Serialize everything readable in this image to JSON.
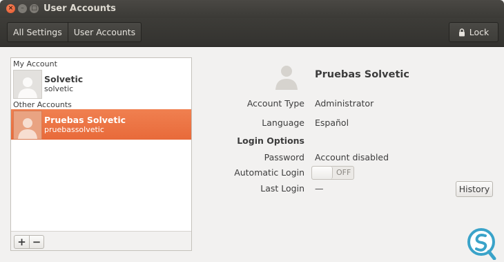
{
  "window": {
    "title": "User Accounts",
    "close_glyph": "×",
    "minimize_glyph": "–",
    "maximize_glyph": "□"
  },
  "toolbar": {
    "breadcrumbs": [
      "All Settings",
      "User Accounts"
    ],
    "lock_label": "Lock",
    "lock_icon": "lock-icon"
  },
  "accounts": {
    "my_account_label": "My Account",
    "other_accounts_label": "Other Accounts",
    "my_account": {
      "name": "Solvetic",
      "username": "solvetic",
      "icon": "user-avatar-icon"
    },
    "others": [
      {
        "name": "Pruebas Solvetic",
        "username": "pruebassolvetic",
        "icon": "user-avatar-icon",
        "selected": true
      }
    ],
    "add_label": "+",
    "remove_label": "−"
  },
  "details": {
    "full_name": "Pruebas Solvetic",
    "account_type_label": "Account Type",
    "account_type_value": "Administrator",
    "language_label": "Language",
    "language_value": "Español",
    "login_options_label": "Login Options",
    "password_label": "Password",
    "password_value": "Account disabled",
    "automatic_login_label": "Automatic Login",
    "automatic_login_state": "OFF",
    "last_login_label": "Last Login",
    "last_login_value": "—",
    "history_label": "History"
  },
  "colors": {
    "selection": "#e86a3a",
    "titlebar": "#3c3b37",
    "watermark": "#3aa3c9"
  }
}
